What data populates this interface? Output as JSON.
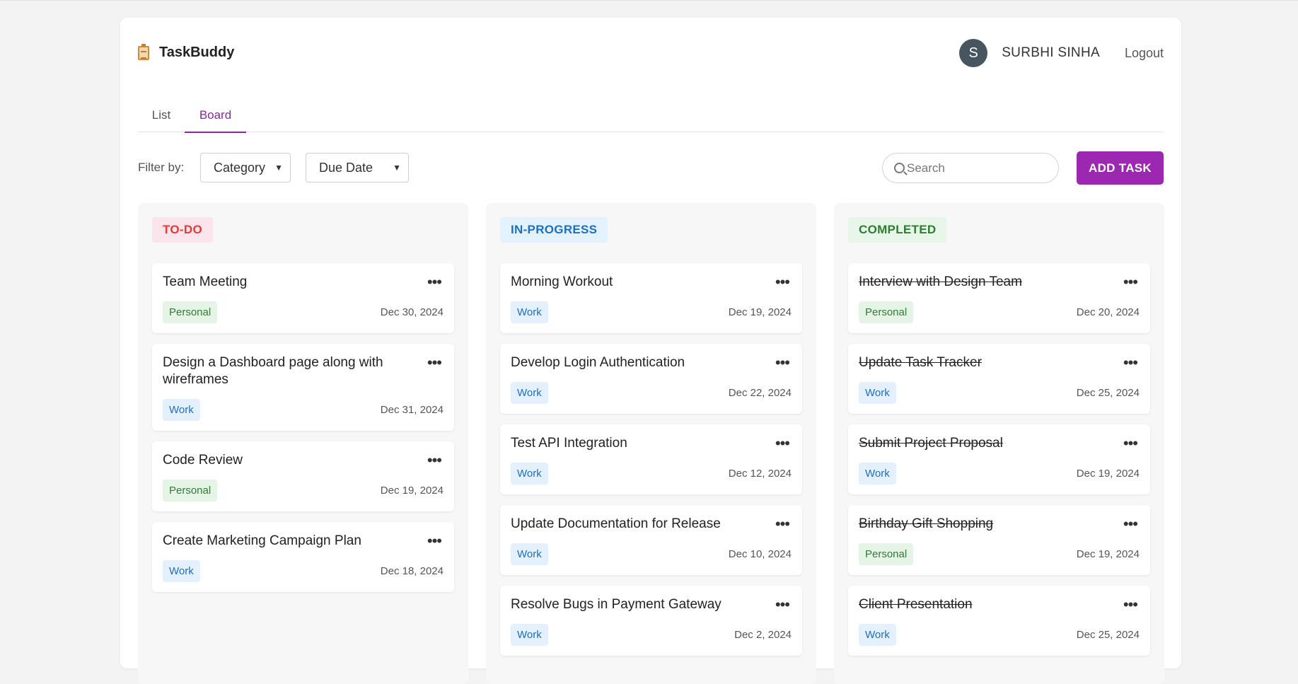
{
  "app": {
    "name": "TaskBuddy"
  },
  "user": {
    "initial": "S",
    "name": "SURBHI SINHA",
    "logout_label": "Logout"
  },
  "tabs": [
    {
      "label": "List"
    },
    {
      "label": "Board"
    }
  ],
  "active_tab": "Board",
  "filters": {
    "label": "Filter by:",
    "category": {
      "selected": "Category"
    },
    "due_date": {
      "selected": "Due Date"
    }
  },
  "search": {
    "placeholder": "Search"
  },
  "add_task_label": "ADD TASK",
  "colors": {
    "accent": "#9c27b0",
    "todo_bg": "#fce4ec",
    "todo_text": "#e53935",
    "inprogress_bg": "#e3f2fd",
    "inprogress_text": "#1e6fc0",
    "completed_bg": "#e8f5e9",
    "completed_text": "#2e7d32"
  },
  "columns": [
    {
      "title": "TO-DO",
      "tasks": [
        {
          "title": "Team Meeting",
          "category": "Personal",
          "due": "Dec 30, 2024"
        },
        {
          "title": "Design a Dashboard page along with wireframes",
          "category": "Work",
          "due": "Dec 31, 2024"
        },
        {
          "title": "Code Review",
          "category": "Personal",
          "due": "Dec 19, 2024"
        },
        {
          "title": "Create Marketing Campaign Plan",
          "category": "Work",
          "due": "Dec 18, 2024"
        }
      ]
    },
    {
      "title": "IN-PROGRESS",
      "tasks": [
        {
          "title": "Morning Workout",
          "category": "Work",
          "due": "Dec 19, 2024"
        },
        {
          "title": "Develop Login Authentication",
          "category": "Work",
          "due": "Dec 22, 2024"
        },
        {
          "title": "Test API Integration",
          "category": "Work",
          "due": "Dec 12, 2024"
        },
        {
          "title": "Update Documentation for Release",
          "category": "Work",
          "due": "Dec 10, 2024"
        },
        {
          "title": "Resolve Bugs in Payment Gateway",
          "category": "Work",
          "due": "Dec 2, 2024"
        }
      ]
    },
    {
      "title": "COMPLETED",
      "tasks": [
        {
          "title": "Interview with Design Team",
          "category": "Personal",
          "due": "Dec 20, 2024"
        },
        {
          "title": "Update Task Tracker",
          "category": "Work",
          "due": "Dec 25, 2024"
        },
        {
          "title": "Submit Project Proposal",
          "category": "Work",
          "due": "Dec 19, 2024"
        },
        {
          "title": "Birthday Gift Shopping",
          "category": "Personal",
          "due": "Dec 19, 2024"
        },
        {
          "title": "Client Presentation",
          "category": "Work",
          "due": "Dec 25, 2024"
        }
      ]
    }
  ]
}
